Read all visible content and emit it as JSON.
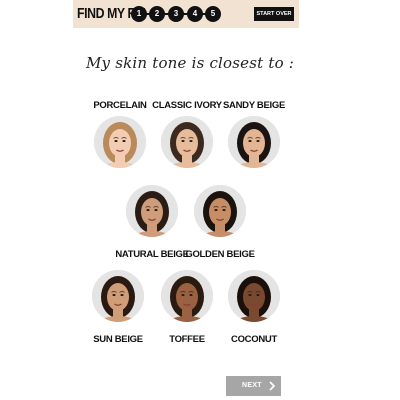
{
  "header": {
    "brand": "FIND MY FIT",
    "steps": [
      "1",
      "2",
      "3",
      "4",
      "5"
    ],
    "start_over_label": "START OVER",
    "background_color": "#f2e2d2"
  },
  "question": "My skin tone is closest to :",
  "skin_tones": [
    {
      "label": "PORCELAIN",
      "skin_color": "#f2cdb4",
      "hair_color": "#b98a5a"
    },
    {
      "label": "CLASSIC IVORY",
      "skin_color": "#e6bc9c",
      "hair_color": "#3d2a1e"
    },
    {
      "label": "SANDY BEIGE",
      "skin_color": "#e2b594",
      "hair_color": "#1c1410"
    },
    {
      "label": "NATURAL BEIGE",
      "skin_color": "#cf9d7c",
      "hair_color": "#2a1c14"
    },
    {
      "label": "GOLDEN BEIGE",
      "skin_color": "#c68d66",
      "hair_color": "#1a120d"
    },
    {
      "label": "SUN BEIGE",
      "skin_color": "#cf9e78",
      "hair_color": "#2a1a12"
    },
    {
      "label": "TOFFEE",
      "skin_color": "#9a6242",
      "hair_color": "#2a1a10"
    },
    {
      "label": "COCONUT",
      "skin_color": "#7a4a30",
      "hair_color": "#1a0f0a"
    }
  ],
  "next": {
    "label": "NEXT",
    "color": "#a6a6a6"
  }
}
